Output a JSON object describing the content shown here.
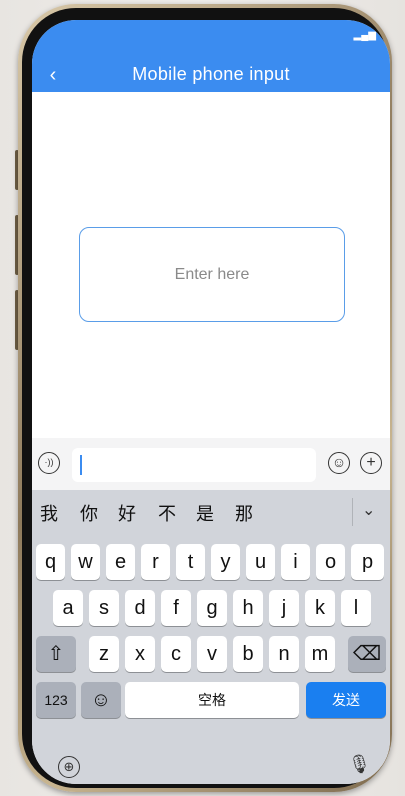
{
  "header": {
    "title": "Mobile phone input",
    "back_icon": "chevron-left-icon",
    "status_signal": "signal-icon"
  },
  "input": {
    "placeholder": "Enter here"
  },
  "keyboard": {
    "candidates": [
      "我",
      "你",
      "好",
      "不",
      "是",
      "那"
    ],
    "row1": [
      "q",
      "w",
      "e",
      "r",
      "t",
      "y",
      "u",
      "i",
      "o",
      "p"
    ],
    "row2": [
      "a",
      "s",
      "d",
      "f",
      "g",
      "h",
      "j",
      "k",
      "l"
    ],
    "row3": [
      "z",
      "x",
      "c",
      "v",
      "b",
      "n",
      "m"
    ],
    "numbers_label": "123",
    "space_label": "空格",
    "send_label": "发送",
    "shift_symbol": "⇧",
    "backspace_symbol": "⌫",
    "emoji_symbol": "☺",
    "collapse_symbol": "⌄"
  },
  "colors": {
    "accent": "#3b8cf0",
    "send": "#1a7ff0",
    "keyboard_bg": "#d1d4da"
  }
}
